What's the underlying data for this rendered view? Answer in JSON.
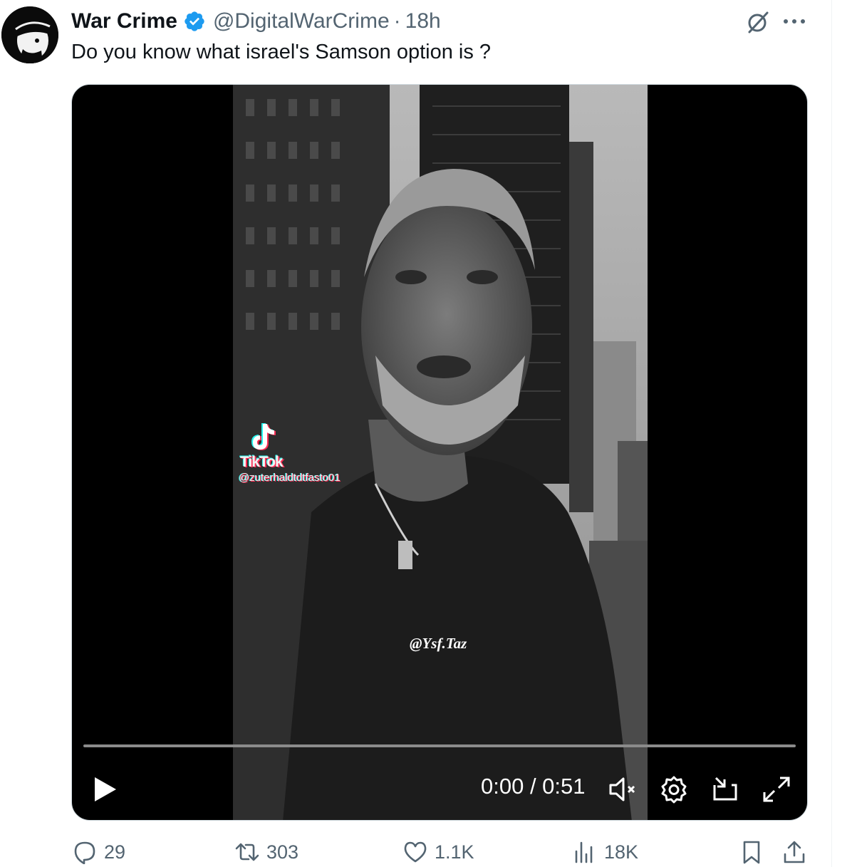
{
  "author": {
    "name": "War Crime",
    "handle": "@DigitalWarCrime",
    "separator": "·",
    "time": "18h",
    "verified": true
  },
  "tweet": {
    "text": "Do you know what israel's Samson  option is ?"
  },
  "video": {
    "tiktok_label": "TikTok",
    "tiktok_user": "@zuterhaldtdtfasto01",
    "watermark": "@Ysf.Taz",
    "time": "0:00 / 0:51",
    "progress": 0
  },
  "actions": {
    "replies": "29",
    "reposts": "303",
    "likes": "1.1K",
    "views": "18K"
  },
  "colors": {
    "verified": "#1d9bf0",
    "secondary_text": "#536471",
    "video_bg": "#000000"
  },
  "icons": [
    "grok-icon",
    "more-icon",
    "play-icon",
    "mute-icon",
    "settings-icon",
    "dock-icon",
    "fullscreen-icon",
    "reply-icon",
    "retweet-icon",
    "like-icon",
    "views-icon",
    "bookmark-icon",
    "share-icon"
  ]
}
